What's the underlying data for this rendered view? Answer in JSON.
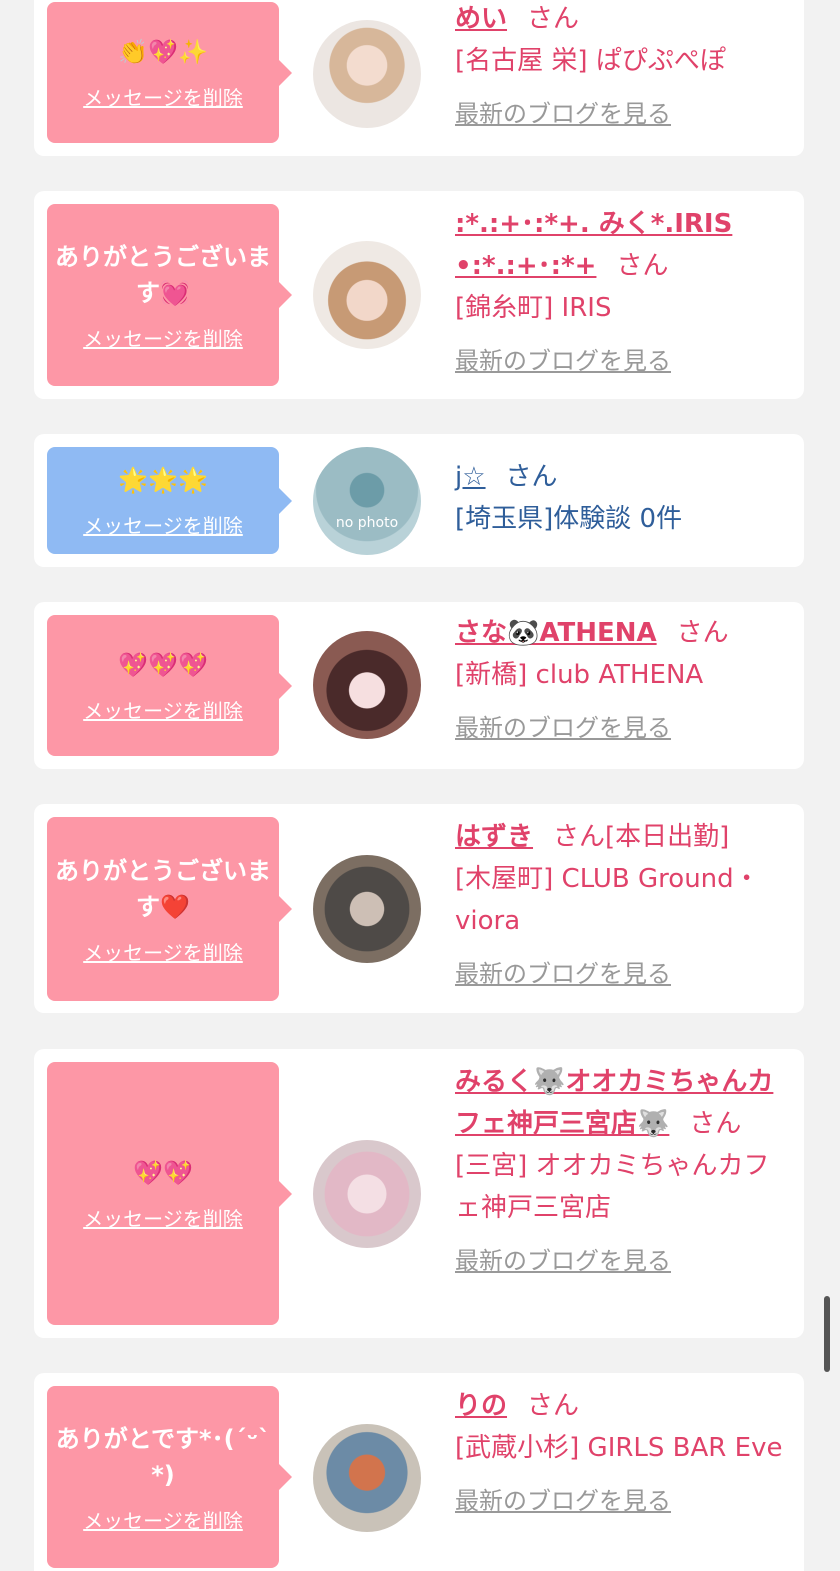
{
  "messages": [
    {
      "bubble_text": "👏💖✨",
      "delete_label": "メッセージを削除",
      "name": "めい",
      "honorific": "さん",
      "status": "",
      "shop": "[名古屋 栄] ぱぴぷぺぽ",
      "blog_label": "最新のブログを見る"
    },
    {
      "bubble_text": "ありがとうございます💓",
      "delete_label": "メッセージを削除",
      "name": ":*.:+･:*+. みく*.IRIS •:*.:+･:*+",
      "honorific": "さん",
      "status": "",
      "shop": "[錦糸町] IRIS",
      "blog_label": "最新のブログを見る"
    },
    {
      "bubble_text": "🌟🌟🌟",
      "delete_label": "メッセージを削除",
      "name": "j☆",
      "honorific": "さん",
      "avatar_placeholder": "no photo",
      "info": "[埼玉県]体験談 0件"
    },
    {
      "bubble_text": "💖💖💖",
      "delete_label": "メッセージを削除",
      "name": "さな🐼ATHENA",
      "honorific": "さん",
      "status": "",
      "shop": "[新橋] club ATHENA",
      "blog_label": "最新のブログを見る"
    },
    {
      "bubble_text": "ありがとうございます❤️",
      "delete_label": "メッセージを削除",
      "name": "はずき",
      "honorific": "さん",
      "status": "[本日出勤]",
      "shop": "[木屋町] CLUB Ground・viora",
      "blog_label": "最新のブログを見る"
    },
    {
      "bubble_text": "💖💖",
      "delete_label": "メッセージを削除",
      "name": "みるく🐺オオカミちゃんカフェ神戸三宮店🐺",
      "honorific": "さん",
      "status": "",
      "shop": "[三宮] オオカミちゃんカフェ神戸三宮店",
      "blog_label": "最新のブログを見る"
    },
    {
      "bubble_text": "ありがとです*･(ˊᵕˋ*)",
      "delete_label": "メッセージを削除",
      "name": "りの",
      "honorific": "さん",
      "status": "",
      "shop": "[武蔵小杉] GIRLS BAR Eve",
      "blog_label": "最新のブログを見る"
    }
  ],
  "colors": {
    "page_bg": "#f2f2f2",
    "bubble_pink": "#fd97a6",
    "bubble_blue": "#8fbaf3",
    "name_pink": "#e0426a",
    "name_blue": "#2f5e9a",
    "blog_link": "#999999"
  }
}
